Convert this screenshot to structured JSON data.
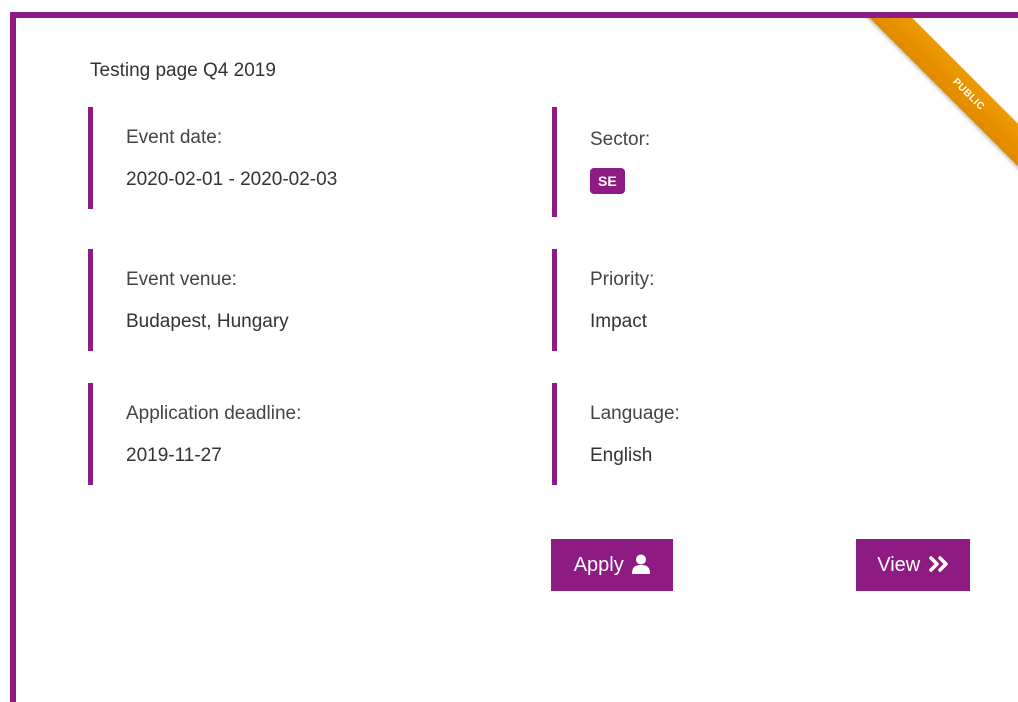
{
  "title": "Testing page Q4 2019",
  "ribbon": "PUBLIC",
  "fields": {
    "event_date": {
      "label": "Event date:",
      "value": "2020-02-01 - 2020-02-03"
    },
    "sector": {
      "label": "Sector:",
      "badge": "SE"
    },
    "event_venue": {
      "label": "Event venue:",
      "value": "Budapest, Hungary"
    },
    "priority": {
      "label": "Priority:",
      "value": "Impact"
    },
    "application_deadline": {
      "label": "Application deadline:",
      "value": "2019-11-27"
    },
    "language": {
      "label": "Language:",
      "value": "English"
    }
  },
  "buttons": {
    "apply": {
      "label": "Apply",
      "icon": "user-icon"
    },
    "view": {
      "label": "View",
      "icon": "double-chevron-right-icon"
    }
  },
  "colors": {
    "accent": "#8e1b82",
    "ribbon": "#e8900a"
  }
}
